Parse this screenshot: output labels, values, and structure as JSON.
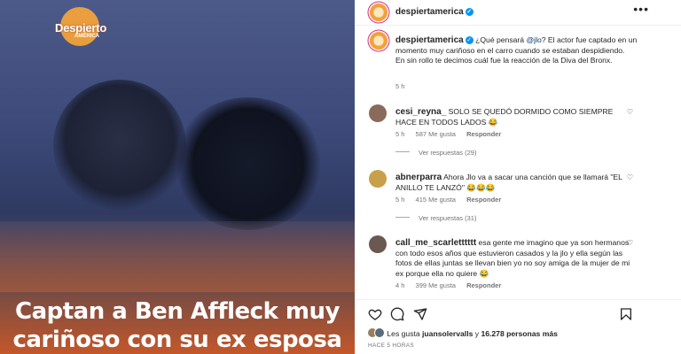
{
  "image": {
    "logo_text": "Despierto",
    "logo_sub": "AMÉRICA",
    "headline_line1": "Captan a Ben Affleck muy",
    "headline_line2": "cariñoso con su ex esposa"
  },
  "post": {
    "account": "despiertamerica",
    "caption_pre": "¿Qué pensará ",
    "caption_mention": "@jlo",
    "caption_post": "? El actor fue captado en un momento muy cariñoso en el carro cuando se estaban despidiendo.",
    "caption_line2": "En sin rollo te decimos cuál fue la reacción de la Diva del Bronx.",
    "caption_time": "5 h"
  },
  "comments": [
    {
      "user": "cesi_reyna_",
      "text": "SOLO SE QUEDÓ DORMIDO COMO SIEMPRE HACE EN TODOS LADOS 😂",
      "time": "5 h",
      "likes": "587 Me gusta",
      "reply": "Responder",
      "replies": "Ver respuestas (29)"
    },
    {
      "user": "abnerparra",
      "text": "Ahora Jlo va a sacar una canción que se llamará \"EL ANILLO TE LANZÓ\" 😂😂😂",
      "time": "5 h",
      "likes": "415 Me gusta",
      "reply": "Responder",
      "replies": "Ver respuestas (31)"
    },
    {
      "user": "call_me_scarletttttt",
      "text": "esa gente me imagino que ya son hermanos con todo esos años que estuvieron casados y la jlo y ella según las fotos de ellas juntas se llevan bien yo no soy amiga de la mujer de mi ex porque ella no quiere 😂",
      "time": "4 h",
      "likes": "399 Me gusta",
      "reply": "Responder"
    }
  ],
  "likes_line": {
    "prefix": "Les gusta ",
    "user": "juansolervalls",
    "suffix": " y ",
    "count": "16.278 personas más"
  },
  "post_time": "HACE 5 HORAS",
  "icons": [
    "more-icon",
    "heart-icon",
    "comment-icon",
    "share-icon",
    "bookmark-icon",
    "verified-icon"
  ]
}
